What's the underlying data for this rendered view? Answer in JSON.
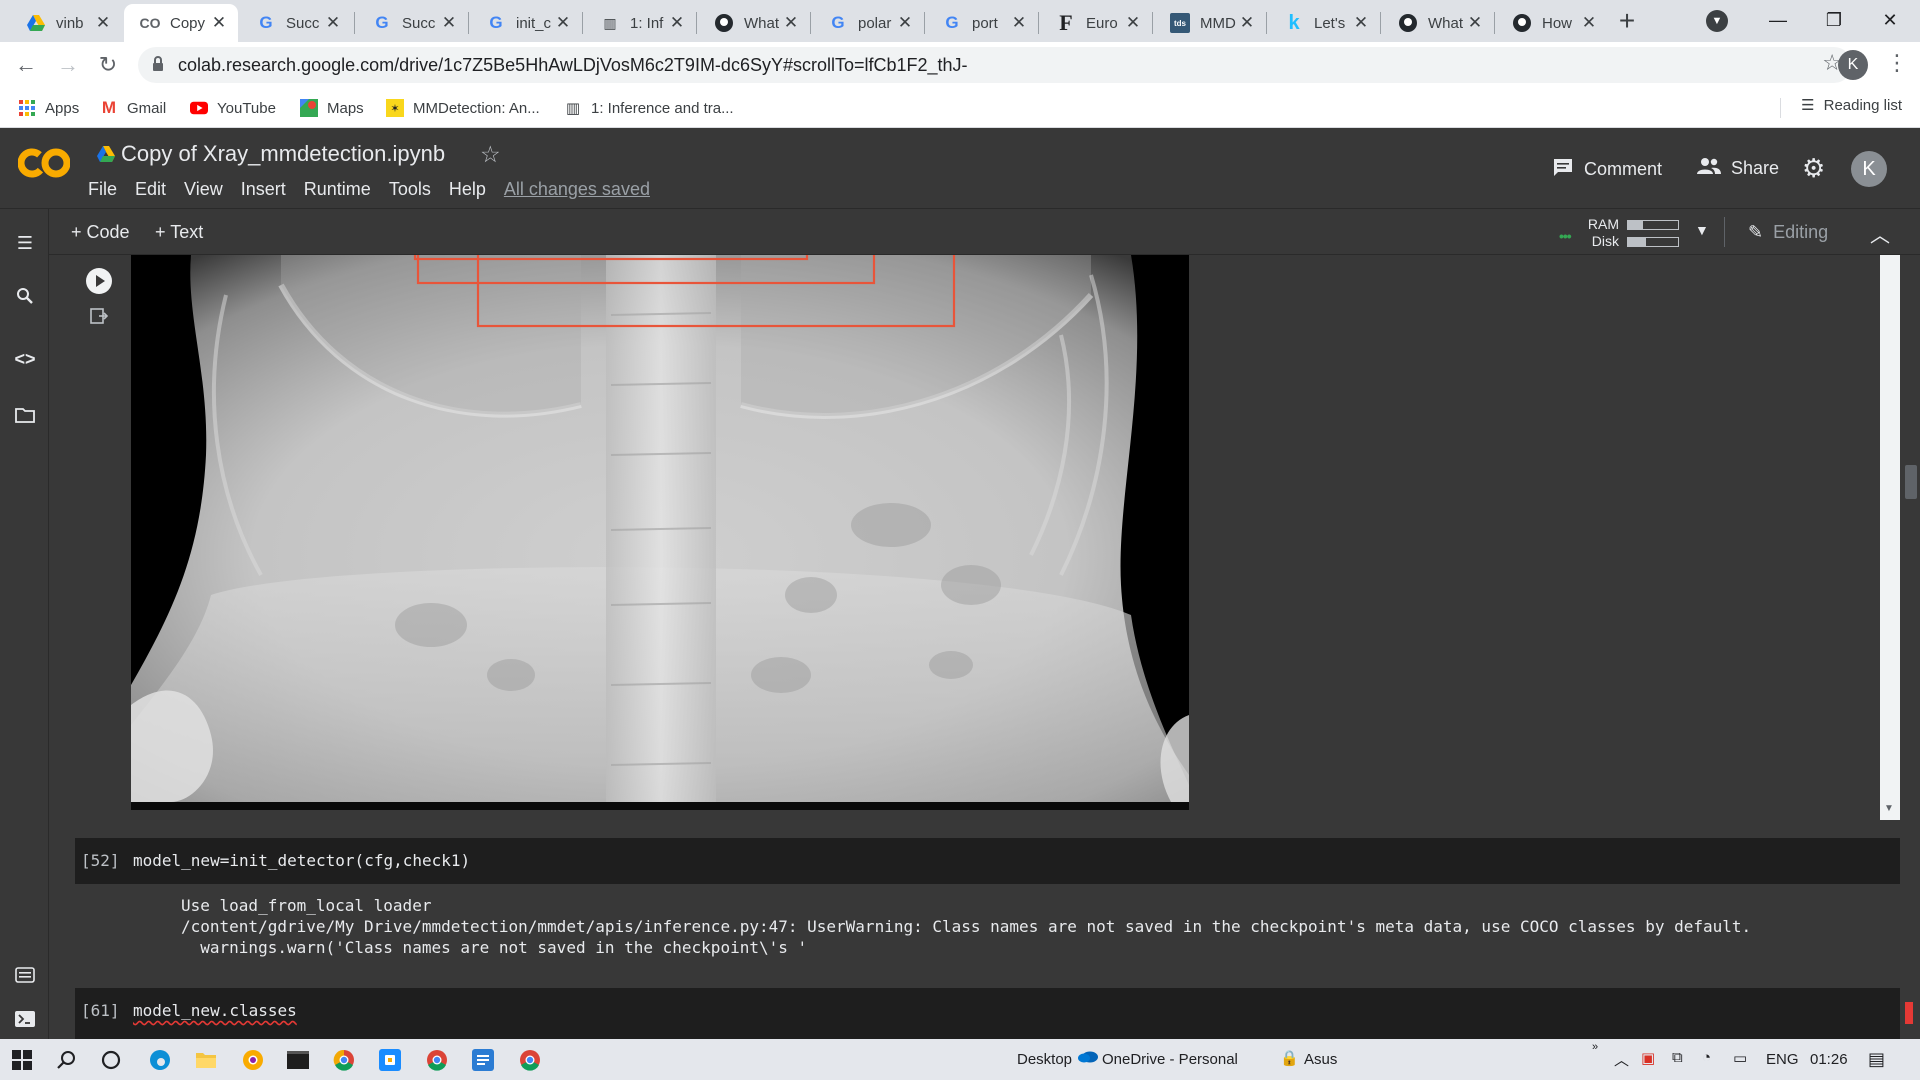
{
  "browser": {
    "tabs": [
      {
        "title": "vinb",
        "icon": "drive-icon",
        "active": false
      },
      {
        "title": "Copy",
        "icon": "colab-icon",
        "active": true
      },
      {
        "title": "Succ",
        "icon": "google-icon",
        "active": false
      },
      {
        "title": "Succ",
        "icon": "google-icon",
        "active": false
      },
      {
        "title": "init_c",
        "icon": "google-icon",
        "active": false
      },
      {
        "title": "1: Inf",
        "icon": "docs-book-icon",
        "active": false
      },
      {
        "title": "What",
        "icon": "github-icon",
        "active": false
      },
      {
        "title": "polar",
        "icon": "google-icon",
        "active": false
      },
      {
        "title": "port",
        "icon": "google-icon",
        "active": false
      },
      {
        "title": "Euro",
        "icon": "f-icon",
        "active": false
      },
      {
        "title": "MMD",
        "icon": "tds-icon",
        "active": false
      },
      {
        "title": "Let's",
        "icon": "k-icon",
        "active": false
      },
      {
        "title": "What",
        "icon": "github-icon",
        "active": false
      },
      {
        "title": "How",
        "icon": "github-icon",
        "active": false
      }
    ],
    "url": "colab.research.google.com/drive/1c7Z5Be5HhAwLDjVosM6c2T9IM-dc6SyY#scrollTo=lfCb1F2_thJ-",
    "profile_initial": "K",
    "bookmarks": [
      {
        "label": "Apps",
        "icon": "apps-grid-icon"
      },
      {
        "label": "Gmail",
        "icon": "gmail-icon"
      },
      {
        "label": "YouTube",
        "icon": "youtube-icon"
      },
      {
        "label": "Maps",
        "icon": "maps-icon"
      },
      {
        "label": "MMDetection: An...",
        "icon": "mmdet-icon"
      },
      {
        "label": "1: Inference and tra...",
        "icon": "docs-book-icon"
      }
    ],
    "reading_list": "Reading list"
  },
  "colab": {
    "title": "Copy of Xray_mmdetection.ipynb",
    "menu": [
      "File",
      "Edit",
      "View",
      "Insert",
      "Runtime",
      "Tools",
      "Help"
    ],
    "save_status": "All changes saved",
    "comment_label": "Comment",
    "share_label": "Share",
    "avatar_initial": "K",
    "add_code": "+ Code",
    "add_text": "+ Text",
    "ram_label": "RAM",
    "disk_label": "Disk",
    "ram_usage": 0.3,
    "disk_usage": 0.35,
    "editing_label": "Editing"
  },
  "cells": [
    {
      "count": "[52]",
      "code": "model_new=init_detector(cfg,check1)",
      "output": [
        "Use load_from_local loader",
        "/content/gdrive/My Drive/mmdetection/mmdet/apis/inference.py:47: UserWarning: Class names are not saved in the checkpoint's meta data, use COCO classes by default.",
        "  warnings.warn('Class names are not saved in the checkpoint\\'s '"
      ]
    },
    {
      "count": "[61]",
      "code": "model_new.classes"
    }
  ],
  "taskbar": {
    "desktop_label": "Desktop",
    "onedrive_label": "OneDrive - Personal",
    "asus_label": "Asus",
    "language": "ENG",
    "time": "01:26"
  },
  "colors": {
    "colab_bg": "#383838",
    "cell_bg": "#1e1e1e",
    "bbox_red": "#e8553a",
    "colab_orange": "#f9ab00"
  }
}
